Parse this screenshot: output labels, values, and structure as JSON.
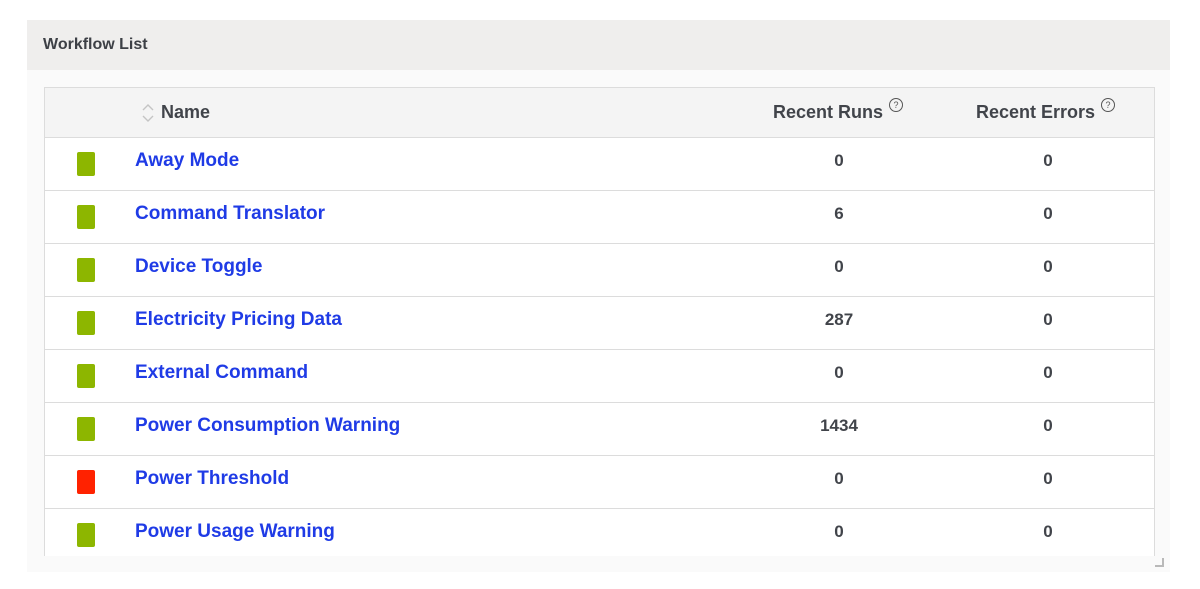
{
  "panel": {
    "title": "Workflow List"
  },
  "table": {
    "headers": {
      "name": "Name",
      "recent_runs": "Recent Runs",
      "recent_errors": "Recent Errors",
      "help_glyph": "?"
    },
    "status_colors": {
      "ok": "#8db600",
      "error": "#ff2200"
    },
    "rows": [
      {
        "name": "Away Mode",
        "runs": "0",
        "errors": "0",
        "status": "ok"
      },
      {
        "name": "Command Translator",
        "runs": "6",
        "errors": "0",
        "status": "ok"
      },
      {
        "name": "Device Toggle",
        "runs": "0",
        "errors": "0",
        "status": "ok"
      },
      {
        "name": "Electricity Pricing Data",
        "runs": "287",
        "errors": "0",
        "status": "ok"
      },
      {
        "name": "External Command",
        "runs": "0",
        "errors": "0",
        "status": "ok"
      },
      {
        "name": "Power Consumption Warning",
        "runs": "1434",
        "errors": "0",
        "status": "ok"
      },
      {
        "name": "Power Threshold",
        "runs": "0",
        "errors": "0",
        "status": "error"
      },
      {
        "name": "Power Usage Warning",
        "runs": "0",
        "errors": "0",
        "status": "ok"
      }
    ]
  },
  "icons": {
    "sort": "sort-icon",
    "help": "help-icon",
    "resize": "resize-handle-icon"
  }
}
